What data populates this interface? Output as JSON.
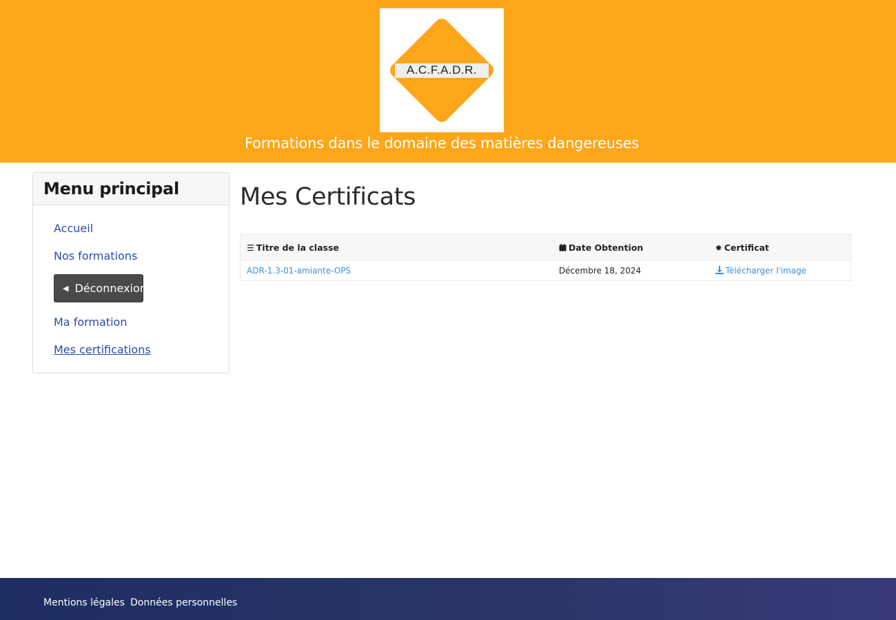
{
  "header": {
    "logo_text": "A.C.F.A.D.R.",
    "tagline": "Formations dans le domaine des matières dangereuses",
    "brand_color": "#fea619"
  },
  "menu": {
    "title": "Menu principal",
    "items": [
      {
        "label": "Accueil"
      },
      {
        "label": "Nos formations"
      },
      {
        "label": "Déconnexion",
        "icon": "caret-left-icon"
      },
      {
        "label": "Ma formation"
      },
      {
        "label": "Mes certifications",
        "active": true
      }
    ]
  },
  "main": {
    "title": "Mes Certificats",
    "table": {
      "headers": [
        {
          "label": "Titre de la classe",
          "icon": "list-icon"
        },
        {
          "label": "Date Obtention",
          "icon": "calendar-icon"
        },
        {
          "label": "Certificat",
          "icon": "badge-icon"
        }
      ],
      "rows": [
        {
          "title": "ADR-1.3-01-amiante-OPS",
          "date": "Décembre 18, 2024",
          "certificate": "Télécharger l'image",
          "certificate_icon": "download-icon"
        }
      ]
    }
  },
  "footer": {
    "links": [
      {
        "label": "Mentions légales"
      },
      {
        "label": "Données personnelles"
      }
    ]
  }
}
